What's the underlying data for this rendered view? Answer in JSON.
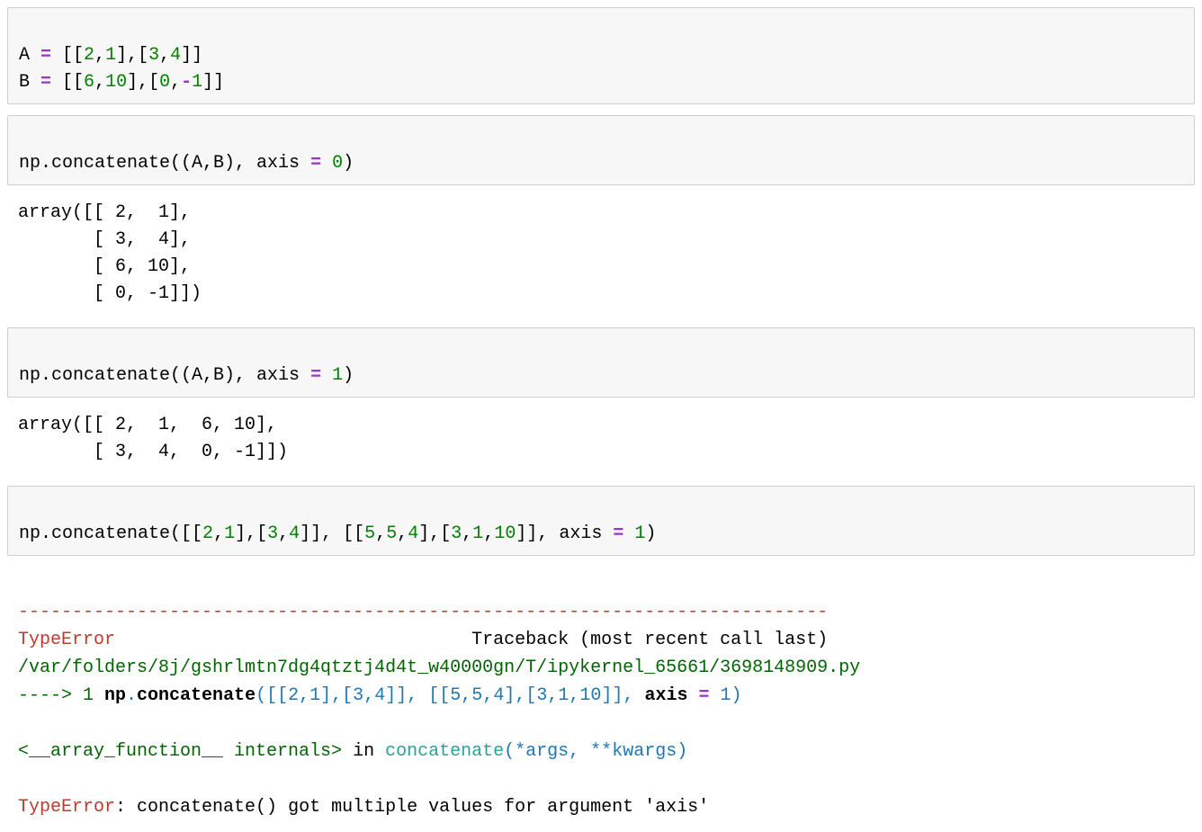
{
  "cell1": {
    "line1": {
      "a_var": "A",
      "equals": " = ",
      "open": "[[",
      "v1": "2",
      "c1": ",",
      "v2": "1",
      "mid": "],[",
      "v3": "3",
      "c2": ",",
      "v4": "4",
      "close": "]]"
    },
    "line2": {
      "b_var": "B",
      "equals": " = ",
      "open": "[[",
      "v1": "6",
      "c1": ",",
      "v2": "10",
      "mid": "],[",
      "v3": "0",
      "c2": ",",
      "neg": "-",
      "v4": "1",
      "close": "]]"
    }
  },
  "cell2": {
    "prefix": "np.concatenate((A,B), axis ",
    "eq": "= ",
    "val": "0",
    "suffix": ")"
  },
  "out2": "array([[ 2,  1],\n       [ 3,  4],\n       [ 6, 10],\n       [ 0, -1]])",
  "cell3": {
    "prefix": "np.concatenate((A,B), axis ",
    "eq": "= ",
    "val": "1",
    "suffix": ")"
  },
  "out3": "array([[ 2,  1,  6, 10],\n       [ 3,  4,  0, -1]])",
  "cell4": {
    "pre1": "np.concatenate([[",
    "v1": "2",
    "c1": ",",
    "v2": "1",
    "mid1": "],[",
    "v3": "3",
    "c2": ",",
    "v4": "4",
    "mid2": "]], [[",
    "v5": "5",
    "c3": ",",
    "v6": "5",
    "c4": ",",
    "v7": "4",
    "mid3": "],[",
    "v8": "3",
    "c5": ",",
    "v9": "1",
    "c6": ",",
    "v10": "10",
    "mid4": "]], axis ",
    "eq": "= ",
    "val": "1",
    "suffix": ")"
  },
  "err": {
    "rule": "---------------------------------------------------------------------------",
    "type_left": "TypeError",
    "type_right": "                                 Traceback (most recent call last)",
    "path": "/var/folders/8j/gshrlmtn7dg4qtztj4d4t_w40000gn/T/ipykernel_65661/3698148909.py",
    "arrow": "----> 1",
    "np": " np",
    "dot": ".",
    "concat": "concatenate",
    "open": "(",
    "arg1_open": "[[",
    "a2": "2",
    "ac1": ",",
    "a1": "1",
    "amid1": "],[",
    "a3": "3",
    "ac2": ",",
    "a4": "4",
    "close1": "]]",
    "sep": ", ",
    "arg2_open": "[[",
    "b5": "5",
    "bc1": ",",
    "b5b": "5",
    "bc2": ",",
    "b4": "4",
    "bmid": "],[",
    "b3": "3",
    "bc3": ",",
    "b1": "1",
    "bc4": ",",
    "b10": "10",
    "close2": "]]",
    "tail_sep": ", ",
    "axis_kw": "axis ",
    "eq": "= ",
    "one": "1",
    "closeall": ")",
    "internals_open": "<__array_function__ internals>",
    "in_word": " in ",
    "concat_teal": "concatenate",
    "sig_open": "(",
    "star": "*",
    "args": "args",
    "sigsep1": ", ",
    "starstar": "**",
    "kwargs": "kwargs",
    "sig_close": ")",
    "final_err": "TypeError",
    "final_msg": ": concatenate() got multiple values for argument 'axis'"
  }
}
